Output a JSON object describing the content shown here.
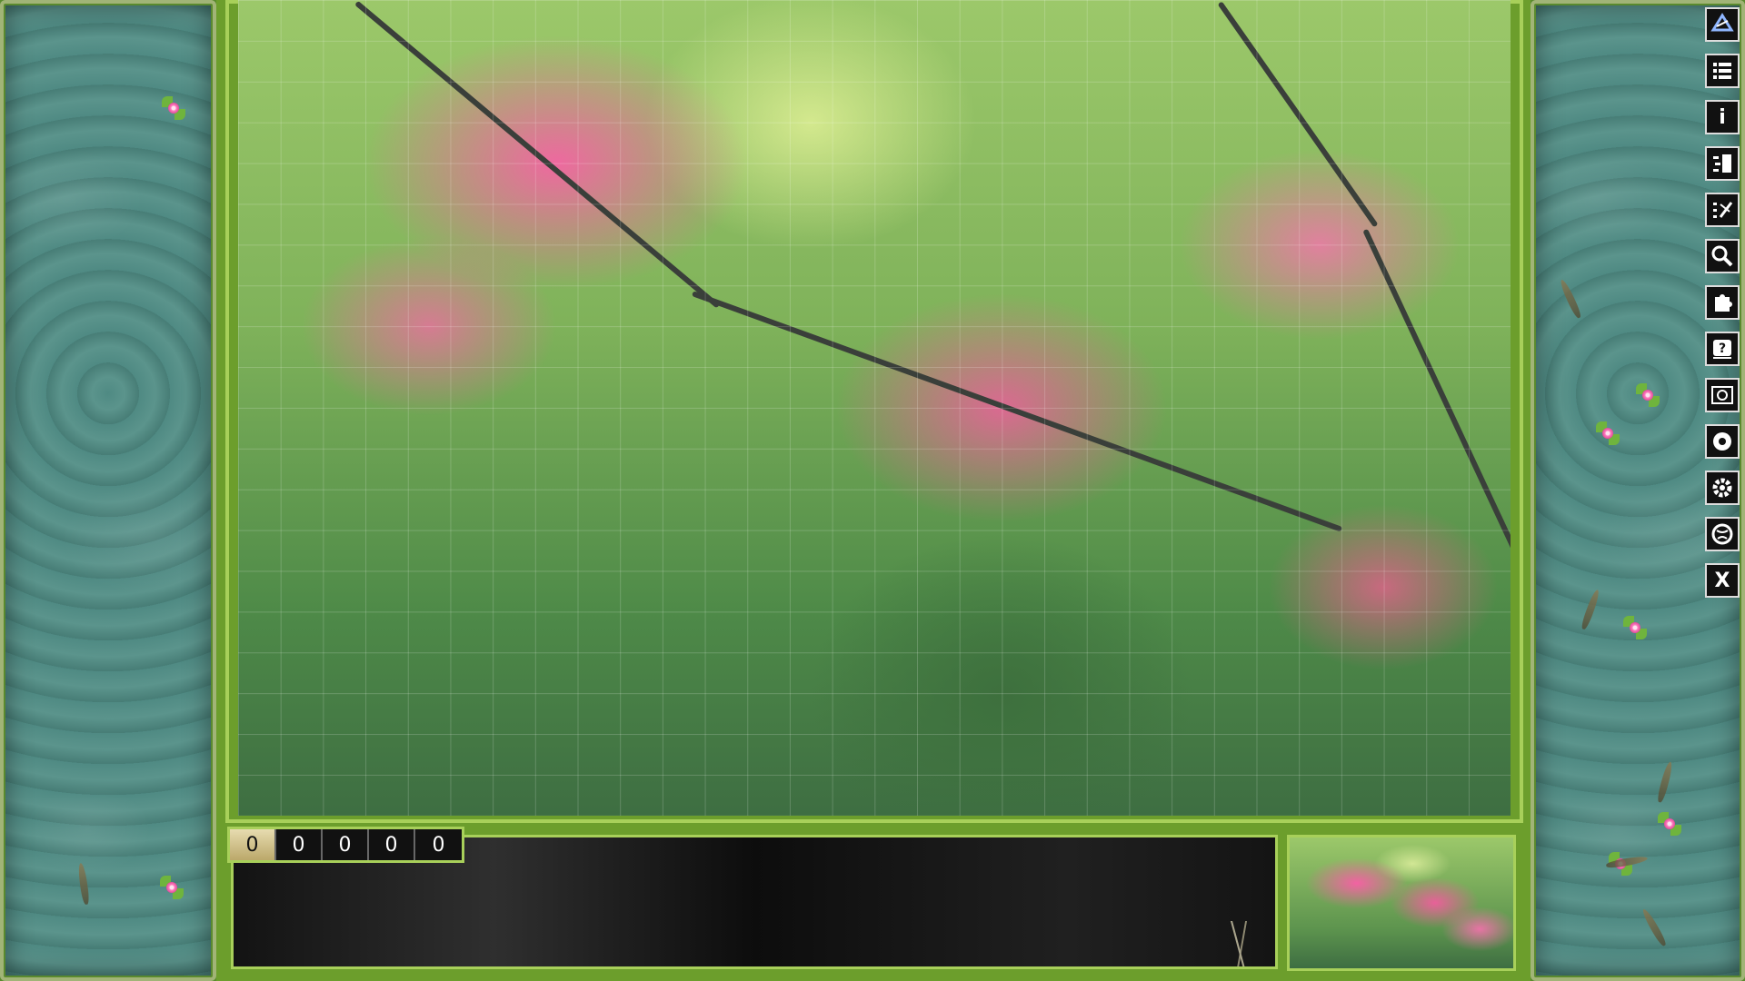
{
  "counter": {
    "digits": [
      "0",
      "0",
      "0",
      "0",
      "0"
    ]
  },
  "toolbar": {
    "tools": [
      {
        "name": "logo-icon"
      },
      {
        "name": "menu-icon"
      },
      {
        "name": "info-icon",
        "glyph": "i"
      },
      {
        "name": "edge-pieces-icon"
      },
      {
        "name": "sort-pieces-icon"
      },
      {
        "name": "search-icon"
      },
      {
        "name": "puzzle-piece-icon"
      },
      {
        "name": "help-icon"
      },
      {
        "name": "screenshot-icon"
      },
      {
        "name": "background-icon"
      },
      {
        "name": "settings-icon"
      },
      {
        "name": "globe-icon"
      },
      {
        "name": "close-icon",
        "glyph": "X"
      }
    ]
  },
  "colors": {
    "frame": "#6c9e2c",
    "frame_border": "#a8d05a",
    "pond": "#4f8a83",
    "toolbar_bg": "#111111"
  }
}
